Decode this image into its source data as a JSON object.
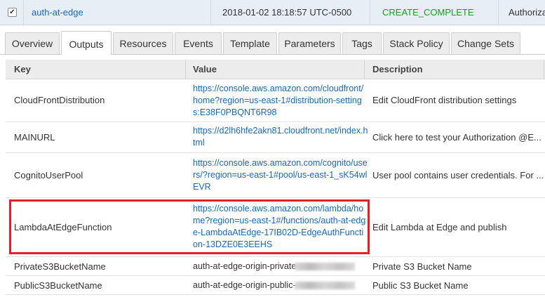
{
  "stack": {
    "checked_mark": "✔",
    "name": "auth-at-edge",
    "created_time": "2018-01-02 18:18:57 UTC-0500",
    "status": "CREATE_COMPLETE",
    "description": "Authorization"
  },
  "tabs": [
    {
      "label": "Overview"
    },
    {
      "label": "Outputs",
      "active": true
    },
    {
      "label": "Resources"
    },
    {
      "label": "Events"
    },
    {
      "label": "Template"
    },
    {
      "label": "Parameters"
    },
    {
      "label": "Tags"
    },
    {
      "label": "Stack Policy"
    },
    {
      "label": "Change Sets"
    }
  ],
  "table": {
    "headers": {
      "key": "Key",
      "value": "Value",
      "description": "Description"
    },
    "rows": [
      {
        "key": "CloudFrontDistribution",
        "value": "https://console.aws.amazon.com/cloudfront/home?region=us-east-1#distribution-settings:E38F0PBQNT6R98",
        "description": "Edit CloudFront distribution settings"
      },
      {
        "key": "MAINURL",
        "value": "https://d2lh6hfe2akn81.cloudfront.net/index.html",
        "description": "Click here to test your Authorization @E..."
      },
      {
        "key": "CognitoUserPool",
        "value": "https://console.aws.amazon.com/cognito/users/?region=us-east-1#pool/us-east-1_sK54wlEVR",
        "description": "User pool contains user credentials. For ..."
      },
      {
        "key": "LambdaAtEdgeFunction",
        "value": "https://console.aws.amazon.com/lambda/home?region=us-east-1#/functions/auth-at-edge-LambdaAtEdge-17IB02D-EdgeAuthFunction-13DZE0E3EEHS",
        "description": "Edit Lambda at Edge and publish"
      },
      {
        "key": "PrivateS3BucketName",
        "value": "auth-at-edge-origin-private",
        "description": "Private S3 Bucket Name"
      },
      {
        "key": "PublicS3BucketName",
        "value": "auth-at-edge-origin-public-",
        "description": "Public S3 Bucket Name"
      }
    ]
  },
  "colors": {
    "link": "#1a66b8",
    "status_ok": "#1b9a1b",
    "highlight_box": "#e2202a"
  }
}
